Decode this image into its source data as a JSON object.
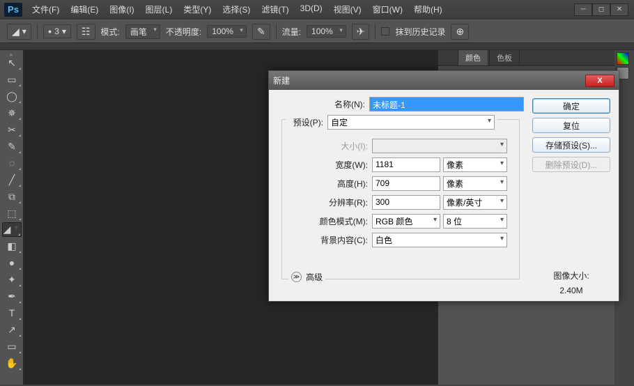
{
  "menu": [
    "文件(F)",
    "编辑(E)",
    "图像(I)",
    "图层(L)",
    "类型(Y)",
    "选择(S)",
    "滤镜(T)",
    "3D(D)",
    "视图(V)",
    "窗口(W)",
    "帮助(H)"
  ],
  "optbar": {
    "brush_size": "3",
    "mode_label": "模式:",
    "mode_value": "画笔",
    "opacity_label": "不透明度:",
    "opacity_value": "100%",
    "flow_label": "流量:",
    "flow_value": "100%",
    "erase_history": "抹到历史记录"
  },
  "panels": {
    "tabs": [
      "颜色",
      "色板"
    ]
  },
  "tools": [
    "↖",
    "▭",
    "◯",
    "✎",
    "✂",
    "↙",
    "◌",
    "╱",
    "⧉",
    "⬚",
    "▰",
    "◧",
    "●",
    "✦",
    "✒",
    "T",
    "↗",
    "✋"
  ],
  "dialog": {
    "title": "新建",
    "name_label": "名称(N):",
    "name_value": "未标题-1",
    "preset_label": "预设(P):",
    "preset_value": "自定",
    "size_label": "大小(I):",
    "width_label": "宽度(W):",
    "width_value": "1181",
    "width_unit": "像素",
    "height_label": "高度(H):",
    "height_value": "709",
    "height_unit": "像素",
    "res_label": "分辨率(R):",
    "res_value": "300",
    "res_unit": "像素/英寸",
    "mode_label": "颜色模式(M):",
    "mode_value": "RGB 颜色",
    "mode_depth": "8 位",
    "bg_label": "背景内容(C):",
    "bg_value": "白色",
    "advanced": "高级",
    "buttons": {
      "ok": "确定",
      "reset": "复位",
      "save": "存储预设(S)...",
      "del": "删除预设(D)..."
    },
    "imgsize_label": "图像大小:",
    "imgsize_value": "2.40M"
  }
}
